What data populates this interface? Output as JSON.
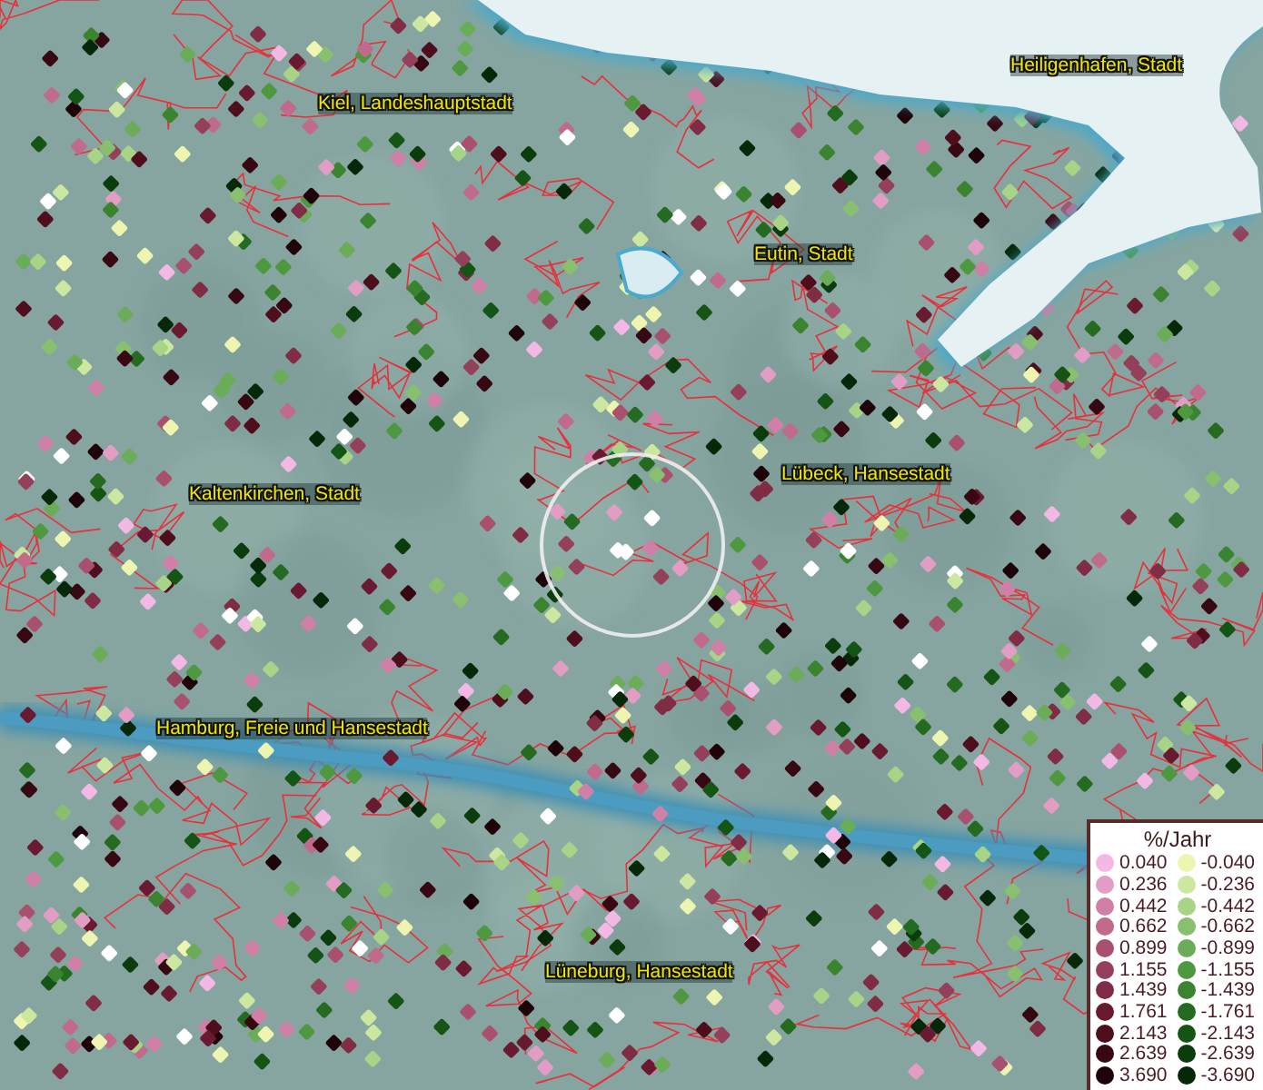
{
  "map": {
    "places": [
      {
        "name": "Heiligenhafen, Stadt"
      },
      {
        "name": "Kiel, Landeshauptstadt"
      },
      {
        "name": "Eutin, Stadt"
      },
      {
        "name": "Lübeck, Hansestadt"
      },
      {
        "name": "Kaltenkirchen, Stadt"
      },
      {
        "name": "Hamburg, Freie und Hansestadt"
      },
      {
        "name": "Lüneburg, Hansestadt"
      }
    ]
  },
  "legend": {
    "title": "%/Jahr",
    "positive": [
      {
        "value": "0.040",
        "color": "#f4b8e4"
      },
      {
        "value": "0.236",
        "color": "#e39cc4"
      },
      {
        "value": "0.442",
        "color": "#d07fa6"
      },
      {
        "value": "0.662",
        "color": "#c06a8c"
      },
      {
        "value": "0.899",
        "color": "#a8506e"
      },
      {
        "value": "1.155",
        "color": "#94405a"
      },
      {
        "value": "1.439",
        "color": "#7f2c44"
      },
      {
        "value": "1.761",
        "color": "#6a1a30"
      },
      {
        "value": "2.143",
        "color": "#4e0e1c"
      },
      {
        "value": "2.639",
        "color": "#380812"
      },
      {
        "value": "3.690",
        "color": "#1e0408"
      }
    ],
    "negative": [
      {
        "value": "-0.040",
        "color": "#eef5b0"
      },
      {
        "value": "-0.236",
        "color": "#cce8a0"
      },
      {
        "value": "-0.442",
        "color": "#a8d488"
      },
      {
        "value": "-0.662",
        "color": "#88c070"
      },
      {
        "value": "-0.899",
        "color": "#6aac58"
      },
      {
        "value": "-1.155",
        "color": "#4e9840"
      },
      {
        "value": "-1.439",
        "color": "#3a8430"
      },
      {
        "value": "-1.761",
        "color": "#246a20"
      },
      {
        "value": "-2.143",
        "color": "#145414"
      },
      {
        "value": "-2.639",
        "color": "#0a3c0c"
      },
      {
        "value": "-3.690",
        "color": "#052808"
      }
    ]
  }
}
